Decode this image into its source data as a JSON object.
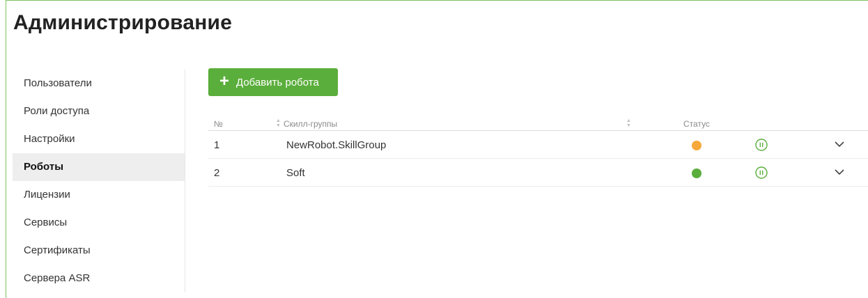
{
  "page": {
    "title": "Администрирование"
  },
  "sidebar": {
    "items": [
      {
        "label": "Пользователи"
      },
      {
        "label": "Роли доступа"
      },
      {
        "label": "Настройки"
      },
      {
        "label": "Роботы"
      },
      {
        "label": "Лицензии"
      },
      {
        "label": "Сервисы"
      },
      {
        "label": "Сертификаты"
      },
      {
        "label": "Сервера ASR"
      }
    ],
    "active_item": "Роботы"
  },
  "toolbar": {
    "add_label": "Добавить робота",
    "add_icon": "plus-icon"
  },
  "table": {
    "columns": {
      "number": "№",
      "skill_groups": "Скилл-группы",
      "status": "Статус"
    },
    "rows": [
      {
        "number": "1",
        "skill_group": "NewRobot.SkillGroup",
        "status_color": "#f7a93b"
      },
      {
        "number": "2",
        "skill_group": "Soft",
        "status_color": "#5aae3b"
      }
    ]
  },
  "colors": {
    "accent": "#5aae3b",
    "pending": "#f7a93b",
    "frame": "#7cc05f"
  }
}
